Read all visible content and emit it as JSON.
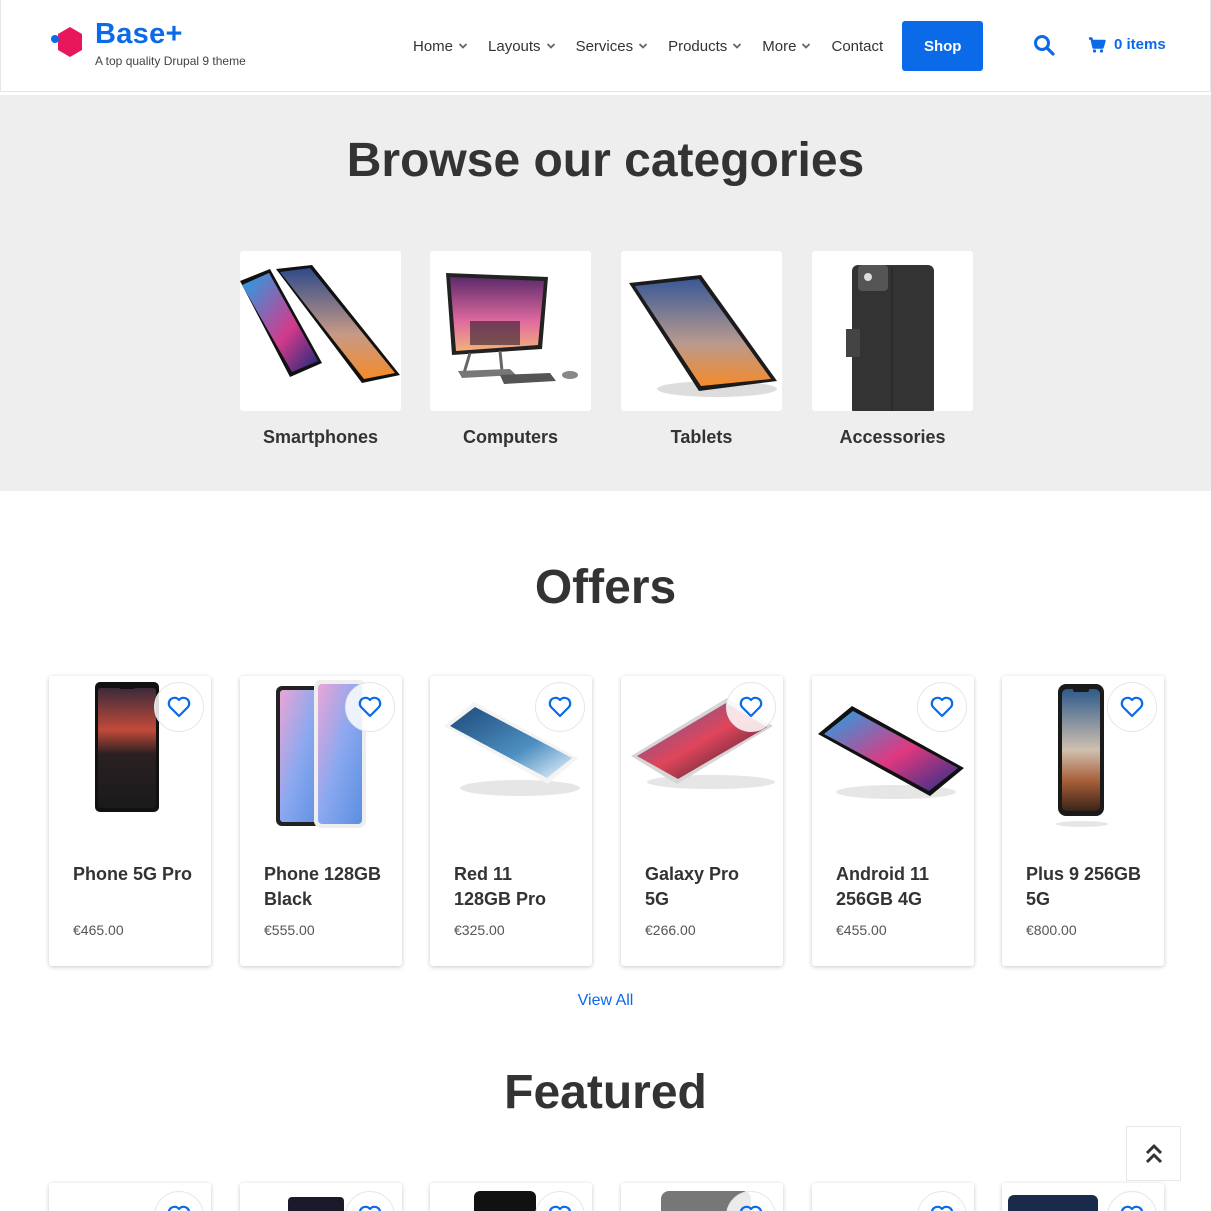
{
  "brand": {
    "title": "Base+",
    "subtitle": "A top quality Drupal 9 theme",
    "accent": "#0b6ae8",
    "logo_color": "#e8165a"
  },
  "nav": {
    "items": [
      {
        "label": "Home",
        "dropdown": true
      },
      {
        "label": "Layouts",
        "dropdown": true
      },
      {
        "label": "Services",
        "dropdown": true
      },
      {
        "label": "Products",
        "dropdown": true
      },
      {
        "label": "More",
        "dropdown": true
      },
      {
        "label": "Contact",
        "dropdown": false
      }
    ],
    "shop_label": "Shop",
    "search_icon": "search-icon",
    "cart_label": "0 items"
  },
  "categories": {
    "title": "Browse our categories",
    "items": [
      {
        "label": "Smartphones"
      },
      {
        "label": "Computers"
      },
      {
        "label": "Tablets"
      },
      {
        "label": "Accessories"
      }
    ]
  },
  "offers": {
    "title": "Offers",
    "products": [
      {
        "name": "Phone 5G Pro",
        "price": "€465.00"
      },
      {
        "name": "Phone 128GB Black",
        "price": "€555.00"
      },
      {
        "name": "Red 11 128GB Pro",
        "price": "€325.00"
      },
      {
        "name": "Galaxy Pro 5G",
        "price": "€266.00"
      },
      {
        "name": "Android 11 256GB 4G",
        "price": "€455.00"
      },
      {
        "name": "Plus 9 256GB 5G",
        "price": "€800.00"
      }
    ],
    "view_all": "View All"
  },
  "featured": {
    "title": "Featured"
  }
}
